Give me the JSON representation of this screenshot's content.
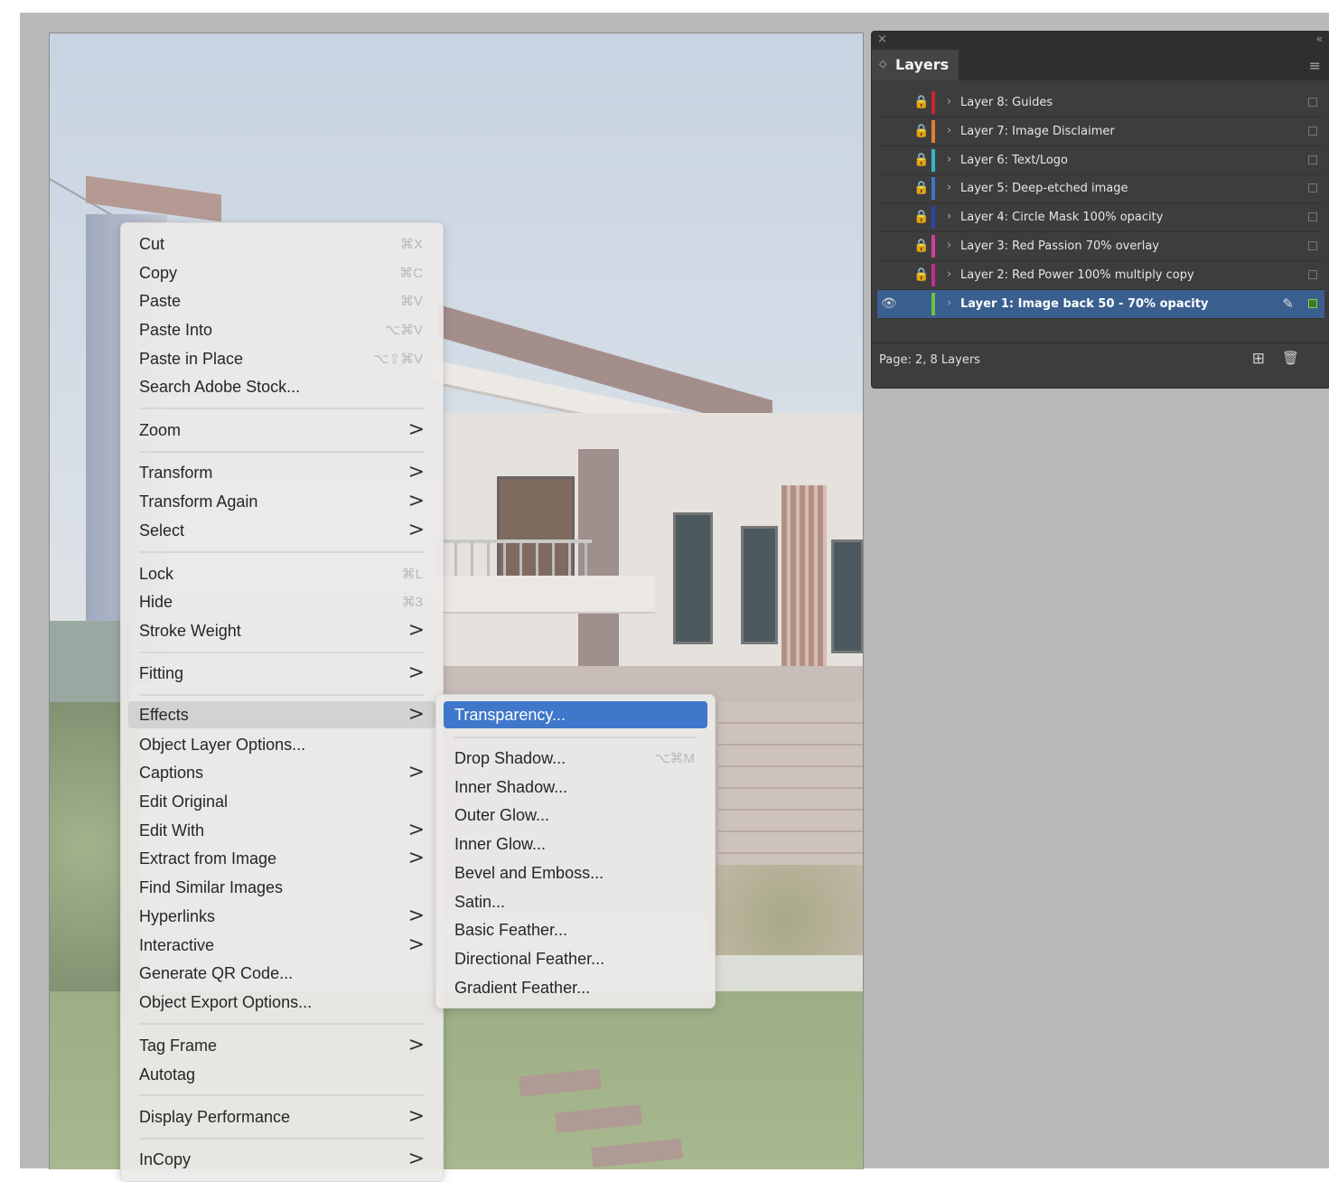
{
  "context_menu": {
    "items": [
      {
        "label": "Cut",
        "shortcut": "⌘X"
      },
      {
        "label": "Copy",
        "shortcut": "⌘C"
      },
      {
        "label": "Paste",
        "shortcut": "⌘V"
      },
      {
        "label": "Paste Into",
        "shortcut": "⌥⌘V"
      },
      {
        "label": "Paste in Place",
        "shortcut": "⌥⇧⌘V"
      },
      {
        "label": "Search Adobe Stock..."
      },
      {
        "label": "Zoom"
      },
      {
        "label": "Transform"
      },
      {
        "label": "Transform Again"
      },
      {
        "label": "Select"
      },
      {
        "label": "Lock",
        "shortcut": "⌘L"
      },
      {
        "label": "Hide",
        "shortcut": "⌘3"
      },
      {
        "label": "Stroke Weight"
      },
      {
        "label": "Fitting"
      },
      {
        "label": "Effects"
      },
      {
        "label": "Object Layer Options..."
      },
      {
        "label": "Captions"
      },
      {
        "label": "Edit Original"
      },
      {
        "label": "Edit With"
      },
      {
        "label": "Extract from Image"
      },
      {
        "label": "Find Similar Images"
      },
      {
        "label": "Hyperlinks"
      },
      {
        "label": "Interactive"
      },
      {
        "label": "Generate QR Code..."
      },
      {
        "label": "Object Export Options..."
      },
      {
        "label": "Tag Frame"
      },
      {
        "label": "Autotag"
      },
      {
        "label": "Display Performance"
      },
      {
        "label": "InCopy"
      }
    ],
    "submenu_arrow": ">"
  },
  "effects_submenu": {
    "items": [
      {
        "label": "Transparency..."
      },
      {
        "label": "Drop Shadow...",
        "shortcut": "⌥⌘M"
      },
      {
        "label": "Inner Shadow..."
      },
      {
        "label": "Outer Glow..."
      },
      {
        "label": "Inner Glow..."
      },
      {
        "label": "Bevel and Emboss..."
      },
      {
        "label": "Satin..."
      },
      {
        "label": "Basic Feather..."
      },
      {
        "label": "Directional Feather..."
      },
      {
        "label": "Gradient Feather..."
      }
    ]
  },
  "layers_panel": {
    "close_glyph": "×",
    "collapse_glyph": "«",
    "tab_label": "Layers",
    "tab_toggle_glyph": "◇",
    "menu_glyph": "≡",
    "lock_glyph": "🔒",
    "eye_glyph": "👁",
    "chevron_glyph": "›",
    "pen_glyph": "✎",
    "layers": [
      {
        "name": "Layer 8: Guides",
        "color": "#c8262c"
      },
      {
        "name": "Layer 7: Image Disclaimer",
        "color": "#e47d2a"
      },
      {
        "name": "Layer 6: Text/Logo",
        "color": "#36b5c9"
      },
      {
        "name": "Layer 5: Deep-etched image",
        "color": "#3c77c6"
      },
      {
        "name": "Layer 4: Circle Mask 100% opacity",
        "color": "#2c44a8"
      },
      {
        "name": "Layer 3: Red Passion 70% overlay",
        "color": "#d23f9d"
      },
      {
        "name": "Layer 2: Red Power 100% multiply copy",
        "color": "#c02f8e"
      },
      {
        "name": "Layer 1: Image back 50 - 70% opacity",
        "color": "#6fc23d"
      }
    ],
    "footer_status": "Page: 2, 8 Layers",
    "new_layer_glyph": "⊞",
    "delete_glyph": "🗑"
  },
  "colors": {
    "selection_blue": "#3f78cb",
    "panel_bg": "#3d3d3d",
    "pasteboard": "#b9b9b9"
  }
}
